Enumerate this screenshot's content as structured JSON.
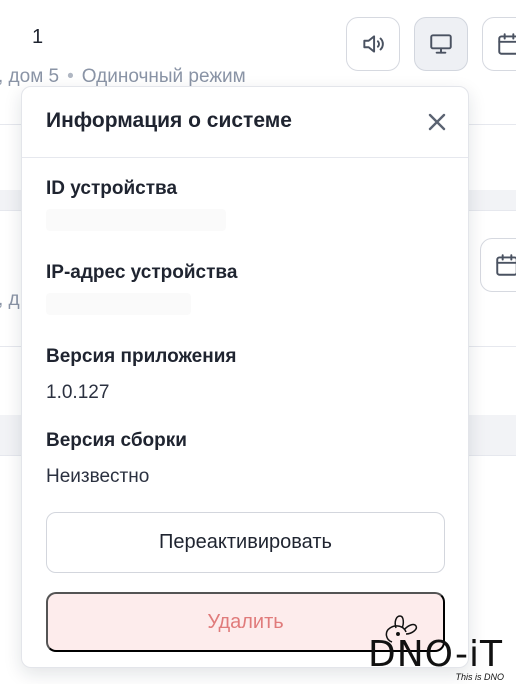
{
  "background": {
    "row_number": "1",
    "address_tail": ", дом 5",
    "mode": "Одиночный режим",
    "address_tail_2": ", д"
  },
  "toolbar": {
    "sound_icon": "speaker-icon",
    "display_icon": "monitor-icon",
    "calendar_icon": "calendar-icon"
  },
  "popover": {
    "title": "Информация о системе",
    "fields": [
      {
        "label": "ID устройства",
        "value": ""
      },
      {
        "label": "IP-адрес устройства",
        "value": ""
      },
      {
        "label": "Версия приложения",
        "value": "1.0.127"
      },
      {
        "label": "Версия сборки",
        "value": "Неизвестно"
      }
    ],
    "reactivate_label": "Переактивировать",
    "delete_label": "Удалить"
  },
  "watermark": {
    "text": "DNO-iT",
    "tagline": "This is DNO"
  },
  "colors": {
    "danger_bg": "#fdecec",
    "danger_text": "#e07b7b",
    "muted_text": "#8a94a6"
  }
}
